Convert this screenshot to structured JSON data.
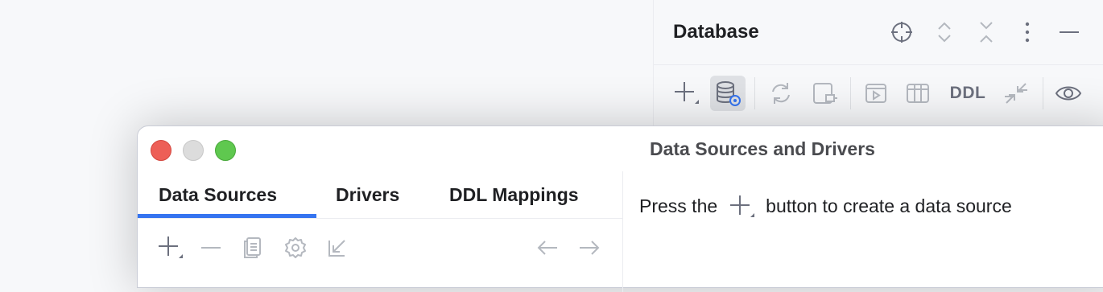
{
  "database_panel": {
    "title": "Database",
    "header_icons": [
      "crosshair-icon",
      "expand-icon",
      "collapse-icon",
      "more-vertical-icon",
      "minimize-icon"
    ],
    "toolbar": {
      "ddl_label": "DDL",
      "icons": [
        "plus-icon",
        "data-source-properties-icon",
        "refresh-icon",
        "disconnect-icon",
        "console-icon",
        "table-icon",
        "ddl-icon",
        "compare-icon",
        "eye-icon"
      ]
    }
  },
  "dialog": {
    "title": "Data Sources and Drivers",
    "tabs": [
      {
        "label": "Data Sources",
        "selected": true
      },
      {
        "label": "Drivers",
        "selected": false
      },
      {
        "label": "DDL Mappings",
        "selected": false
      }
    ],
    "left_toolbar_icons": [
      "plus-icon",
      "minus-icon",
      "copy-icon",
      "settings-icon",
      "import-icon",
      "back-arrow-icon",
      "forward-arrow-icon"
    ],
    "hint": {
      "before": "Press the",
      "after": "button to create a data source"
    }
  },
  "colors": {
    "accent": "#3574f0",
    "close": "#ed5f57",
    "minimize": "#dcdcdc",
    "maximize": "#5fc84f"
  }
}
